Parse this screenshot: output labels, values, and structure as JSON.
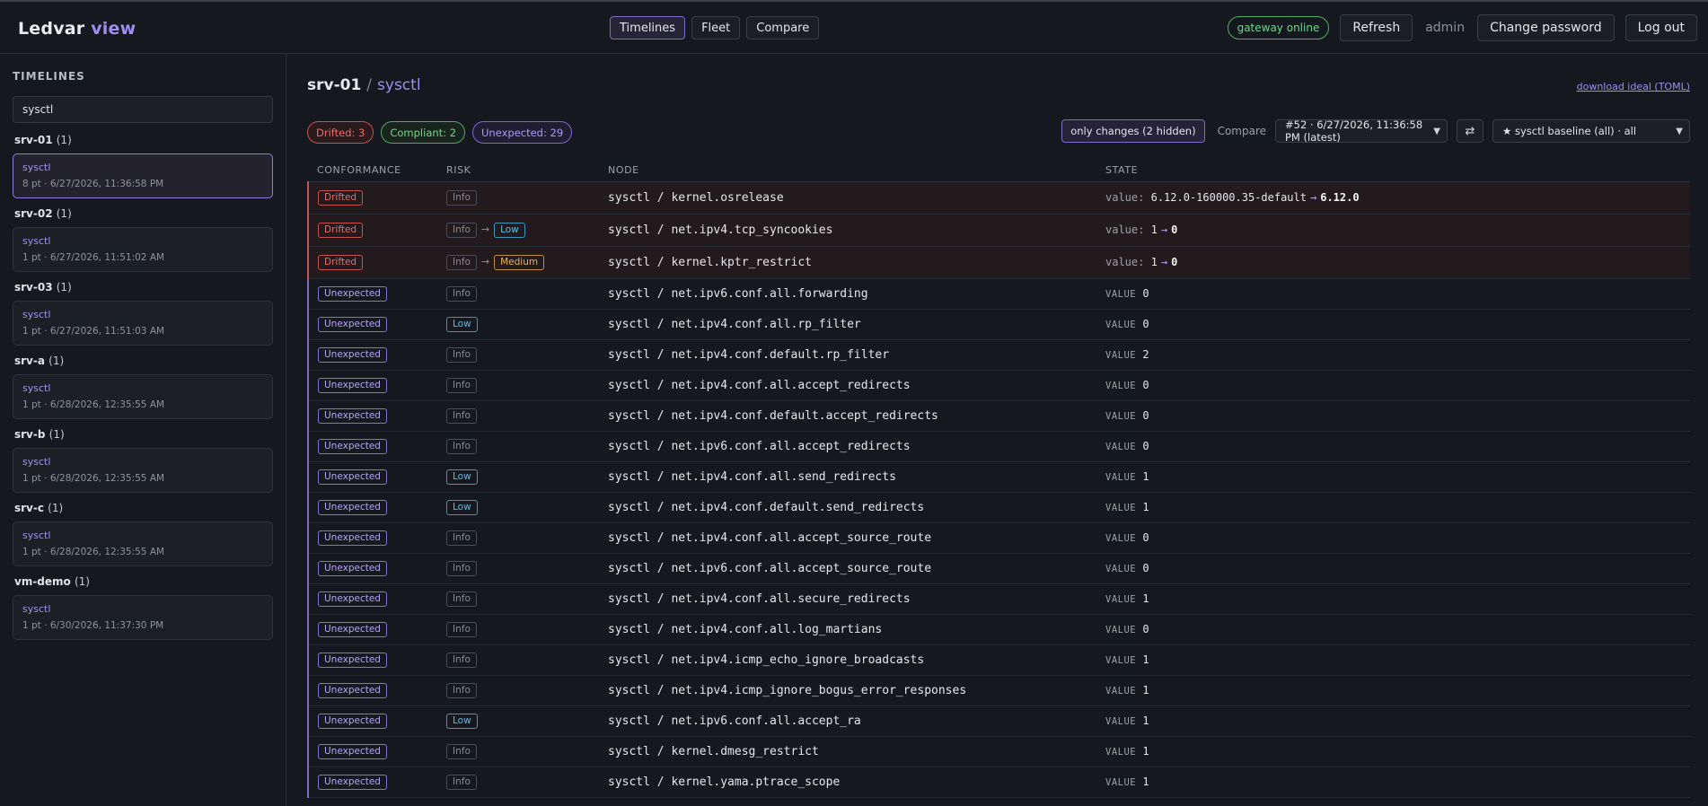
{
  "app": {
    "brand_main": "Ledvar",
    "brand_accent": "view"
  },
  "nav": {
    "tabs": [
      "Timelines",
      "Fleet",
      "Compare"
    ],
    "active": "Timelines"
  },
  "header_right": {
    "gateway_status": "gateway online",
    "refresh_label": "Refresh",
    "user": "admin",
    "change_password_label": "Change password",
    "logout_label": "Log out"
  },
  "sidebar": {
    "title": "TIMELINES",
    "search_value": "sysctl",
    "groups": [
      {
        "host": "srv-01",
        "count": "(1)",
        "item": {
          "name": "sysctl",
          "meta": "8 pt · 6/27/2026, 11:36:58 PM"
        }
      },
      {
        "host": "srv-02",
        "count": "(1)",
        "item": {
          "name": "sysctl",
          "meta": "1 pt · 6/27/2026, 11:51:02 AM"
        }
      },
      {
        "host": "srv-03",
        "count": "(1)",
        "item": {
          "name": "sysctl",
          "meta": "1 pt · 6/27/2026, 11:51:03 AM"
        }
      },
      {
        "host": "srv-a",
        "count": "(1)",
        "item": {
          "name": "sysctl",
          "meta": "1 pt · 6/28/2026, 12:35:55 AM"
        }
      },
      {
        "host": "srv-b",
        "count": "(1)",
        "item": {
          "name": "sysctl",
          "meta": "1 pt · 6/28/2026, 12:35:55 AM"
        }
      },
      {
        "host": "srv-c",
        "count": "(1)",
        "item": {
          "name": "sysctl",
          "meta": "1 pt · 6/28/2026, 12:35:55 AM"
        }
      },
      {
        "host": "vm-demo",
        "count": "(1)",
        "item": {
          "name": "sysctl",
          "meta": "1 pt · 6/30/2026, 11:37:30 PM"
        }
      }
    ]
  },
  "main": {
    "crumb_host": "srv-01",
    "crumb_sep": "/",
    "crumb_leaf": "sysctl",
    "download_link": "download ideal (TOML)",
    "summary": {
      "drifted": "Drifted: 3",
      "compliant": "Compliant: 2",
      "unexpected": "Unexpected: 29"
    },
    "controls": {
      "only_changes": "only changes (2 hidden)",
      "compare_label": "Compare",
      "compare_select": "#52 · 6/27/2026, 11:36:58 PM (latest)",
      "swap_icon": "⇄",
      "baseline_select": "★ sysctl baseline (all) · all"
    },
    "columns": [
      "CONFORMANCE",
      "RISK",
      "NODE",
      "STATE"
    ],
    "rows": [
      {
        "status": "Drifted",
        "risk": "Info",
        "risk_to": "",
        "node": "sysctl / kernel.osrelease",
        "state_label": "value:",
        "old": "6.12.0-160000.35-default",
        "new": "6.12.0"
      },
      {
        "status": "Drifted",
        "risk": "Info",
        "risk_to": "Low",
        "node": "sysctl / net.ipv4.tcp_syncookies",
        "state_label": "value:",
        "old": "1",
        "new": "0"
      },
      {
        "status": "Drifted",
        "risk": "Info",
        "risk_to": "Medium",
        "node": "sysctl / kernel.kptr_restrict",
        "state_label": "value:",
        "old": "1",
        "new": "0"
      },
      {
        "status": "Unexpected",
        "risk": "Info",
        "node": "sysctl / net.ipv6.conf.all.forwarding",
        "state_label": "VALUE",
        "value": "0"
      },
      {
        "status": "Unexpected",
        "risk": "Low",
        "node": "sysctl / net.ipv4.conf.all.rp_filter",
        "state_label": "VALUE",
        "value": "0"
      },
      {
        "status": "Unexpected",
        "risk": "Info",
        "node": "sysctl / net.ipv4.conf.default.rp_filter",
        "state_label": "VALUE",
        "value": "2"
      },
      {
        "status": "Unexpected",
        "risk": "Info",
        "node": "sysctl / net.ipv4.conf.all.accept_redirects",
        "state_label": "VALUE",
        "value": "0"
      },
      {
        "status": "Unexpected",
        "risk": "Info",
        "node": "sysctl / net.ipv4.conf.default.accept_redirects",
        "state_label": "VALUE",
        "value": "0"
      },
      {
        "status": "Unexpected",
        "risk": "Info",
        "node": "sysctl / net.ipv6.conf.all.accept_redirects",
        "state_label": "VALUE",
        "value": "0"
      },
      {
        "status": "Unexpected",
        "risk": "Low",
        "node": "sysctl / net.ipv4.conf.all.send_redirects",
        "state_label": "VALUE",
        "value": "1"
      },
      {
        "status": "Unexpected",
        "risk": "Low",
        "node": "sysctl / net.ipv4.conf.default.send_redirects",
        "state_label": "VALUE",
        "value": "1"
      },
      {
        "status": "Unexpected",
        "risk": "Info",
        "node": "sysctl / net.ipv4.conf.all.accept_source_route",
        "state_label": "VALUE",
        "value": "0"
      },
      {
        "status": "Unexpected",
        "risk": "Info",
        "node": "sysctl / net.ipv6.conf.all.accept_source_route",
        "state_label": "VALUE",
        "value": "0"
      },
      {
        "status": "Unexpected",
        "risk": "Info",
        "node": "sysctl / net.ipv4.conf.all.secure_redirects",
        "state_label": "VALUE",
        "value": "1"
      },
      {
        "status": "Unexpected",
        "risk": "Info",
        "node": "sysctl / net.ipv4.conf.all.log_martians",
        "state_label": "VALUE",
        "value": "0"
      },
      {
        "status": "Unexpected",
        "risk": "Info",
        "node": "sysctl / net.ipv4.icmp_echo_ignore_broadcasts",
        "state_label": "VALUE",
        "value": "1"
      },
      {
        "status": "Unexpected",
        "risk": "Info",
        "node": "sysctl / net.ipv4.icmp_ignore_bogus_error_responses",
        "state_label": "VALUE",
        "value": "1"
      },
      {
        "status": "Unexpected",
        "risk": "Low",
        "node": "sysctl / net.ipv6.conf.all.accept_ra",
        "state_label": "VALUE",
        "value": "1"
      },
      {
        "status": "Unexpected",
        "risk": "Info",
        "node": "sysctl / kernel.dmesg_restrict",
        "state_label": "VALUE",
        "value": "1"
      },
      {
        "status": "Unexpected",
        "risk": "Info",
        "node": "sysctl / kernel.yama.ptrace_scope",
        "state_label": "VALUE",
        "value": "1"
      }
    ]
  },
  "colors": {
    "accent": "#a28cf0",
    "drifted": "#ef6a6a",
    "compliant": "#77d48e",
    "low": "#5bbde8",
    "medium": "#e8b450"
  }
}
